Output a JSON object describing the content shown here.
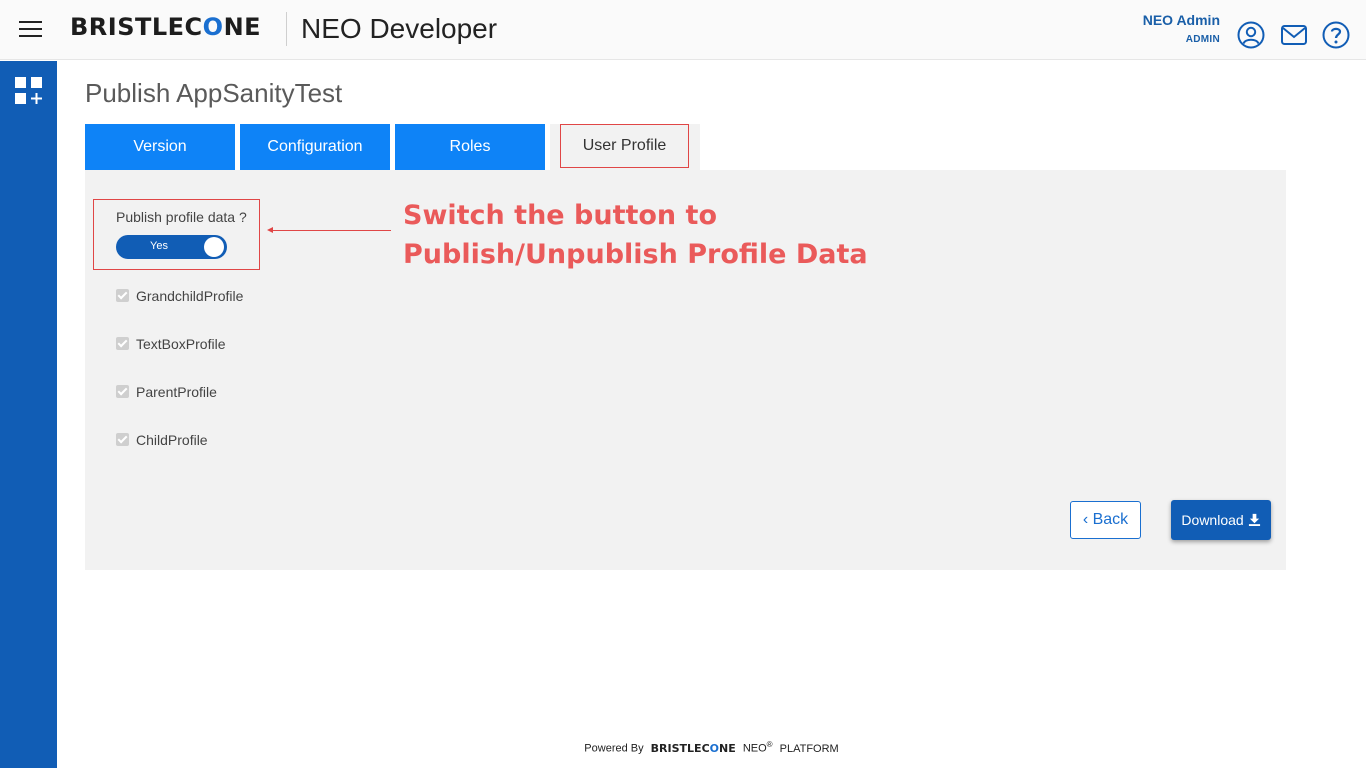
{
  "header": {
    "brand_prefix": "BRISTLEC",
    "brand_accent": "O",
    "brand_suffix": "NE",
    "app_title": "NEO Developer",
    "user_name": "NEO Admin",
    "user_role": "ADMIN",
    "icons": [
      "user-circle-icon",
      "mail-icon",
      "help-icon"
    ]
  },
  "leftnav": {
    "icon": "apps-add-icon"
  },
  "page": {
    "title": "Publish AppSanityTest"
  },
  "tabs": [
    {
      "label": "Version"
    },
    {
      "label": "Configuration"
    },
    {
      "label": "Roles"
    },
    {
      "label": "User Profile",
      "active": true
    }
  ],
  "publish": {
    "label": "Publish profile data ?",
    "toggle_label": "Yes",
    "toggle_on": true
  },
  "annotation": {
    "line1": "Switch the button to",
    "line2": "Publish/Unpublish Profile Data"
  },
  "profiles": [
    {
      "name": "GrandchildProfile",
      "checked": true
    },
    {
      "name": "TextBoxProfile",
      "checked": true
    },
    {
      "name": "ParentProfile",
      "checked": true
    },
    {
      "name": "ChildProfile",
      "checked": true
    }
  ],
  "buttons": {
    "back_label": "Back",
    "download_label": "Download"
  },
  "footer": {
    "powered_by": "Powered By",
    "brand_prefix": "BRISTLEC",
    "brand_accent": "O",
    "brand_suffix": "NE",
    "neo": "NEO",
    "reg": "®",
    "platform": "PLATFORM"
  },
  "colors": {
    "primary": "#115db5",
    "tab_blue": "#0e83f7",
    "annotation_red": "#ea5a5a",
    "highlight_border": "#e04646"
  }
}
